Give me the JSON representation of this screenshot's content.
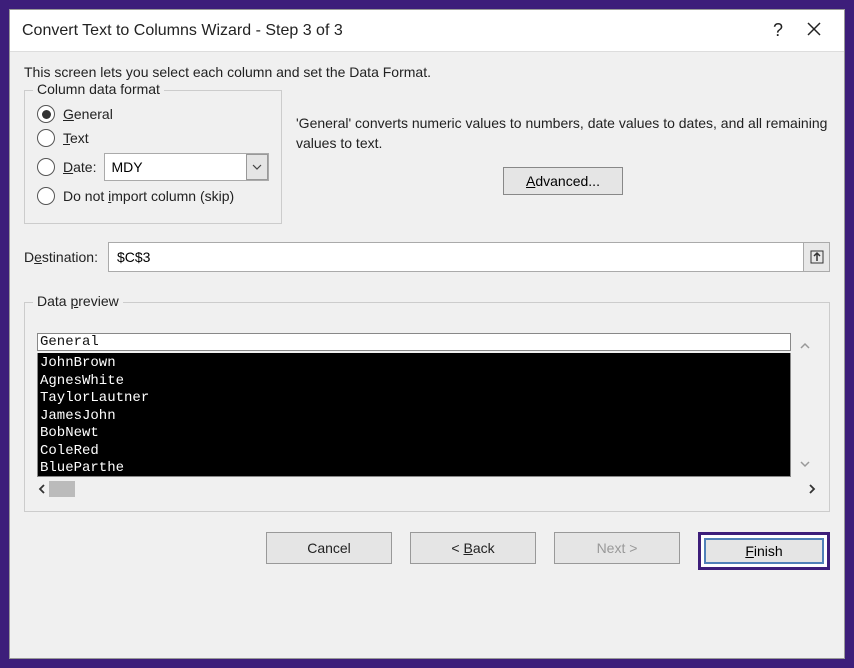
{
  "title": "Convert Text to Columns Wizard - Step 3 of 3",
  "intro": "This screen lets you select each column and set the Data Format.",
  "column_data_format": {
    "legend": "Column data format",
    "options": {
      "general": "General",
      "text": "Text",
      "date": "Date:",
      "skip": "Do not import column (skip)"
    },
    "date_value": "MDY",
    "selected": "general"
  },
  "description": "'General' converts numeric values to numbers, date values to dates, and all remaining values to text.",
  "advanced_label": "Advanced...",
  "destination": {
    "label": "Destination:",
    "value": "$C$3"
  },
  "preview": {
    "legend": "Data preview",
    "header": "General",
    "rows": [
      "JohnBrown",
      "AgnesWhite",
      "TaylorLautner",
      "JamesJohn",
      "BobNewt",
      "ColeRed",
      "BlueParthe"
    ]
  },
  "buttons": {
    "cancel": "Cancel",
    "back": "< Back",
    "next": "Next >",
    "finish": "Finish"
  }
}
